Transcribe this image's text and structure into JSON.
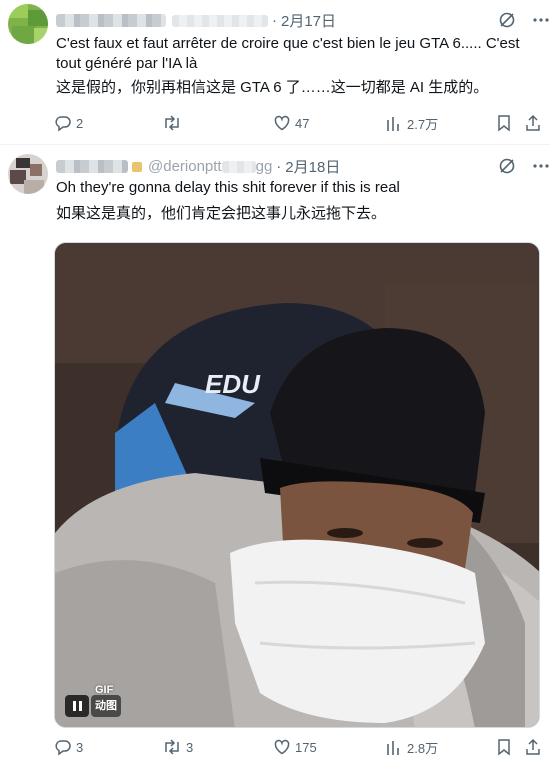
{
  "tweets": [
    {
      "date": "2月17日",
      "text": "C'est faux et faut arrêter de croire que c'est bien le jeu GTA 6..... C'est tout généré par l'IA là",
      "translation": "这是假的，你别再相信这是 GTA 6 了……这一切都是 AI 生成的。",
      "replies": "2",
      "retweets": "",
      "likes": "47",
      "views": "2.7万"
    },
    {
      "handle": "@derionptt",
      "handle_tail": "gg",
      "date": "2月18日",
      "text": "Oh they're gonna delay this shit forever if this is real",
      "translation": "如果这是真的，他们肯定会把这事儿永远拖下去。",
      "media": {
        "gif_label": "GIF",
        "gif_sub": "动图",
        "logo_text": "EDU"
      },
      "replies": "3",
      "retweets": "3",
      "likes": "175",
      "views": "2.8万"
    }
  ],
  "icons": [
    "translate-icon",
    "more-icon",
    "reply-icon",
    "retweet-icon",
    "like-icon",
    "views-icon",
    "bookmark-icon",
    "share-icon",
    "pause-icon"
  ],
  "colors": {
    "text": "#0f1419",
    "secondary": "#536471",
    "divider": "#eff3f4"
  }
}
